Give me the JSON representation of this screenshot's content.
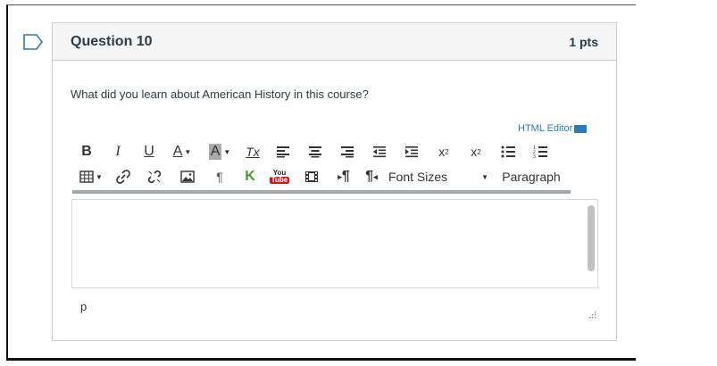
{
  "question": {
    "title": "Question 10",
    "points": "1 pts",
    "text": "What did you learn about American History in this course?"
  },
  "editor": {
    "html_editor_link": "HTML Editor",
    "font_sizes_label": "Font Sizes",
    "paragraph_label": "Paragraph",
    "status_path": "p",
    "content": ""
  },
  "toolbar_row1": [
    "bold",
    "italic",
    "underline",
    "text-color",
    "background-color",
    "clear-formatting",
    "align-left",
    "align-center",
    "align-right",
    "outdent",
    "indent",
    "superscript",
    "subscript",
    "bullet-list",
    "numbered-list"
  ],
  "toolbar_row2": [
    "table",
    "link",
    "unlink",
    "image",
    "show-blocks",
    "kaltura",
    "youtube",
    "media",
    "ltr",
    "rtl",
    "font-sizes",
    "paragraph"
  ],
  "icon_labels": {
    "bold": "B",
    "italic": "I",
    "underline": "U",
    "text_color": "A",
    "background_color": "A",
    "clear_formatting": "Tx",
    "pilcrow": "¶",
    "kaltura": "K",
    "youtube_top": "You",
    "youtube_bottom": "Tube"
  },
  "colors": {
    "link": "#2b7abc",
    "header_bg": "#f5f5f5",
    "border": "#c7cdd1",
    "kaltura": "#4a9c2a",
    "youtube": "#cc181e"
  }
}
